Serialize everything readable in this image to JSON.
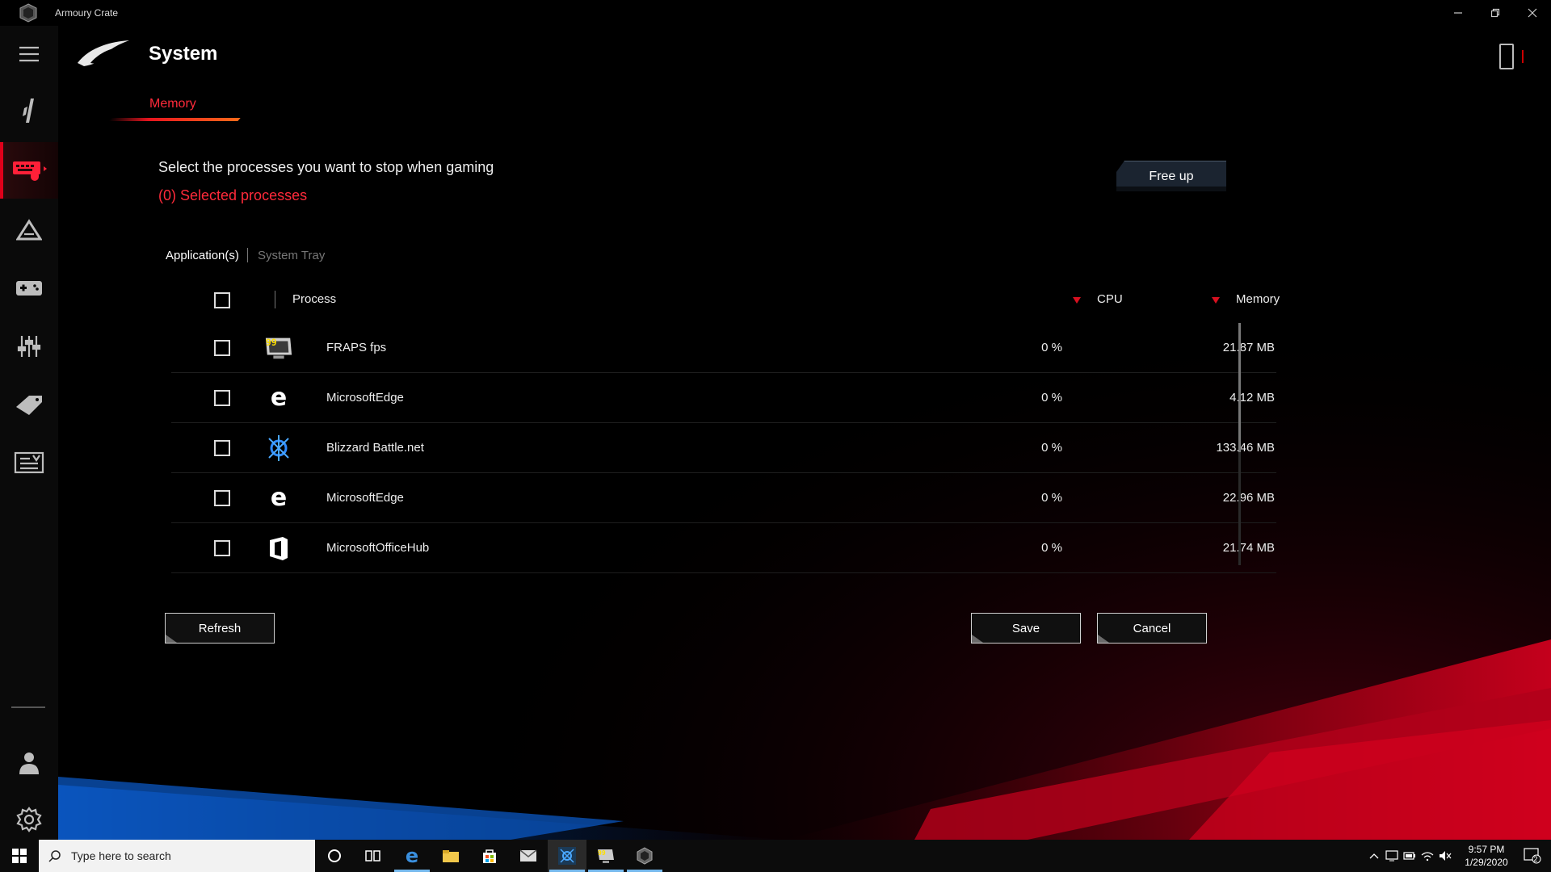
{
  "window": {
    "title": "Armoury Crate",
    "minimize": "—",
    "restore": "❐",
    "close": "✕"
  },
  "rail": {
    "items": [
      {
        "name": "menu",
        "icon": "hamburger-icon"
      },
      {
        "name": "home",
        "icon": "device-bar-icon"
      },
      {
        "name": "system",
        "icon": "keyboard-icon",
        "active": true
      },
      {
        "name": "aura",
        "icon": "triangle-icon"
      },
      {
        "name": "devices",
        "icon": "gamepad-icon"
      },
      {
        "name": "game-visual",
        "icon": "sliders-icon"
      },
      {
        "name": "deals",
        "icon": "tag-icon"
      },
      {
        "name": "news",
        "icon": "newspaper-icon"
      },
      {
        "name": "user",
        "icon": "user-icon"
      },
      {
        "name": "settings",
        "icon": "gear-icon"
      }
    ]
  },
  "header": {
    "title": "System"
  },
  "tabs": {
    "memory": "Memory"
  },
  "memory": {
    "instruction": "Select the processes you want to stop when gaming",
    "selected_count": "(0) Selected processes",
    "free_up": "Free up",
    "subtabs": {
      "apps": "Application(s)",
      "tray": "System Tray"
    },
    "columns": {
      "process": "Process",
      "cpu": "CPU",
      "memory": "Memory"
    },
    "rows": [
      {
        "name": "FRAPS fps",
        "icon": "fraps-icon",
        "cpu": "0 %",
        "memory": "21.87 MB"
      },
      {
        "name": "MicrosoftEdge",
        "icon": "edge-icon",
        "cpu": "0 %",
        "memory": "4.12 MB"
      },
      {
        "name": "Blizzard Battle.net",
        "icon": "battlenet-icon",
        "cpu": "0 %",
        "memory": "133.46 MB"
      },
      {
        "name": "MicrosoftEdge",
        "icon": "edge-icon",
        "cpu": "0 %",
        "memory": "22.96 MB"
      },
      {
        "name": "MicrosoftOfficeHub",
        "icon": "office-icon",
        "cpu": "0 %",
        "memory": "21.74 MB"
      }
    ],
    "buttons": {
      "refresh": "Refresh",
      "save": "Save",
      "cancel": "Cancel"
    }
  },
  "taskbar": {
    "search_placeholder": "Type here to search",
    "time": "9:57 PM",
    "date": "1/29/2020",
    "notification_count": "2"
  },
  "colors": {
    "accent": "#e6141e",
    "accent_text": "#ff2a3a",
    "background": "#000000"
  }
}
